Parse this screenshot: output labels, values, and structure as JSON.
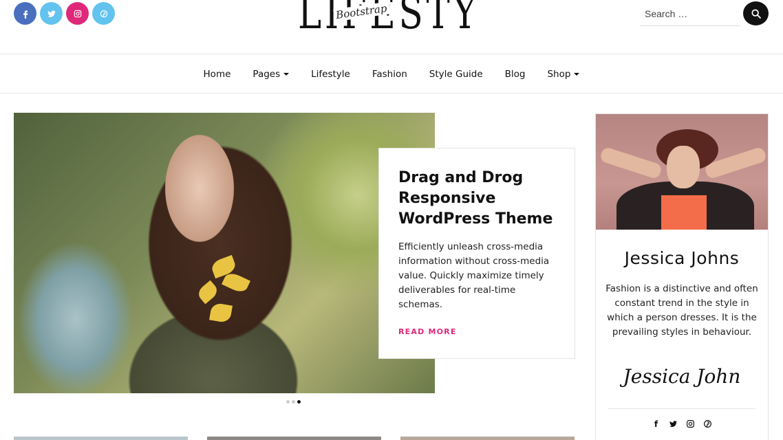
{
  "header": {
    "logo_main": "LIFESTYLE",
    "logo_sub": "Bootstrap",
    "search_placeholder": "Search …",
    "socials": [
      {
        "icon": "facebook-icon",
        "glyph": "f",
        "color": "#4a6fbf"
      },
      {
        "icon": "twitter-icon",
        "glyph": "t",
        "color": "#62c3ee"
      },
      {
        "icon": "instagram-icon",
        "glyph": "◎",
        "color": "#e0287a"
      },
      {
        "icon": "pinterest-icon",
        "glyph": "p",
        "color": "#62c3ee"
      }
    ]
  },
  "nav": {
    "items": [
      {
        "label": "Home",
        "dropdown": false
      },
      {
        "label": "Pages",
        "dropdown": true
      },
      {
        "label": "Lifestyle",
        "dropdown": false
      },
      {
        "label": "Fashion",
        "dropdown": false
      },
      {
        "label": "Style Guide",
        "dropdown": false
      },
      {
        "label": "Blog",
        "dropdown": false
      },
      {
        "label": "Shop",
        "dropdown": true
      }
    ]
  },
  "slider": {
    "title": "Drag and Drog Responsive WordPress Theme",
    "text": "Efficiently unleash cross-media information without cross-media value. Quickly maximize timely deliverables for real-time schemas.",
    "link": "READ MORE",
    "accent": "#e0287a",
    "active_slide": 3,
    "total_slides": 3
  },
  "sidebar": {
    "name": "Jessica Johns",
    "bio": "Fashion is a distinctive and often constant trend in the style in which a person dresses. It is the prevailing styles in behaviour.",
    "signature": "Jessica John",
    "socials": [
      "facebook-icon",
      "twitter-icon",
      "instagram-icon",
      "pinterest-icon"
    ]
  }
}
